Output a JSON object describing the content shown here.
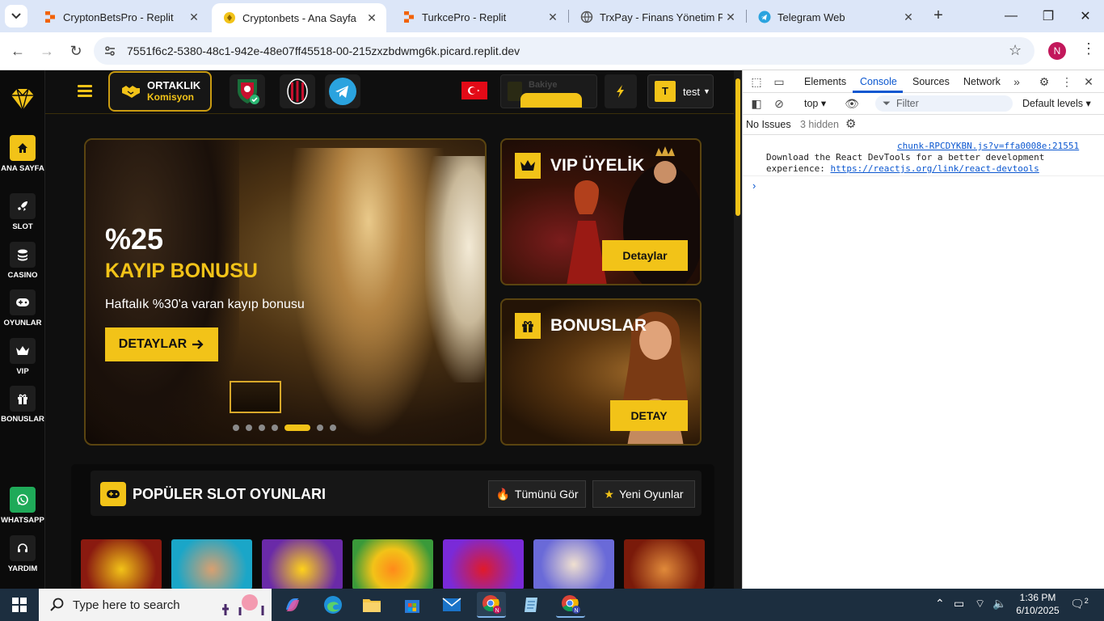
{
  "browser": {
    "tabs": [
      {
        "title": "CryptonBetsPro - Replit",
        "active": false
      },
      {
        "title": "Cryptonbets - Ana Sayfa",
        "active": true
      },
      {
        "title": "TurkcePro - Replit",
        "active": false
      },
      {
        "title": "TrxPay - Finans Yönetim Paneli",
        "active": false
      },
      {
        "title": "Telegram Web",
        "active": false
      }
    ],
    "url": "7551f6c2-5380-48c1-942e-48e07ff45518-00-215zxzbdwmg6k.picard.replit.dev",
    "profile_initial": "N"
  },
  "site": {
    "sidebar": [
      {
        "label": "ANA SAYFA",
        "icon": "home-icon",
        "active": true
      },
      {
        "label": "SLOT",
        "icon": "rocket-icon"
      },
      {
        "label": "CASINO",
        "icon": "coins-icon"
      },
      {
        "label": "OYUNLAR",
        "icon": "gamepad-icon"
      },
      {
        "label": "VIP",
        "icon": "crown-icon"
      },
      {
        "label": "BONUSLAR",
        "icon": "gift-icon"
      },
      {
        "label": "WHATSAPP",
        "icon": "whatsapp-icon"
      },
      {
        "label": "YARDIM",
        "icon": "headset-icon"
      }
    ],
    "topbar": {
      "ortaklik_line1": "ORTAKLIK",
      "ortaklik_line2": "Komisyon",
      "balance_label": "Bakiye",
      "user_initial": "T",
      "username": "test"
    },
    "hero": {
      "percent": "%25",
      "title": "KAYIP BONUSU",
      "subtitle": "Haftalık %30'a varan kayıp bonusu",
      "button": "DETAYLAR",
      "slide_count": 7,
      "active_slide": 5
    },
    "vip_card": {
      "title": "VIP ÜYELİK",
      "button": "Detaylar"
    },
    "bonus_card": {
      "title": "BONUSLAR",
      "button": "DETAY"
    },
    "popular": {
      "title": "POPÜLER SLOT OYUNLARI",
      "all_button": "Tümünü Gör",
      "new_button": "Yeni Oyunlar"
    }
  },
  "devtools": {
    "tabs": [
      "Elements",
      "Console",
      "Sources",
      "Network"
    ],
    "active_tab": "Console",
    "context": "top",
    "filter_placeholder": "Filter",
    "levels": "Default levels",
    "issues": "No Issues",
    "hidden": "3 hidden",
    "log_source": "chunk-RPCDYKBN.js?v=ffa0008e:21551",
    "log_message": "Download the React DevTools for a better development experience: ",
    "log_link": "https://reactjs.org/link/react-devtools"
  },
  "taskbar": {
    "search_placeholder": "Type here to search",
    "time": "1:36 PM",
    "date": "6/10/2025",
    "notifications": "2"
  },
  "colors": {
    "accent": "#f2c318",
    "site_bg": "#0f0f0f",
    "devtools_blue": "#0b57d0"
  }
}
